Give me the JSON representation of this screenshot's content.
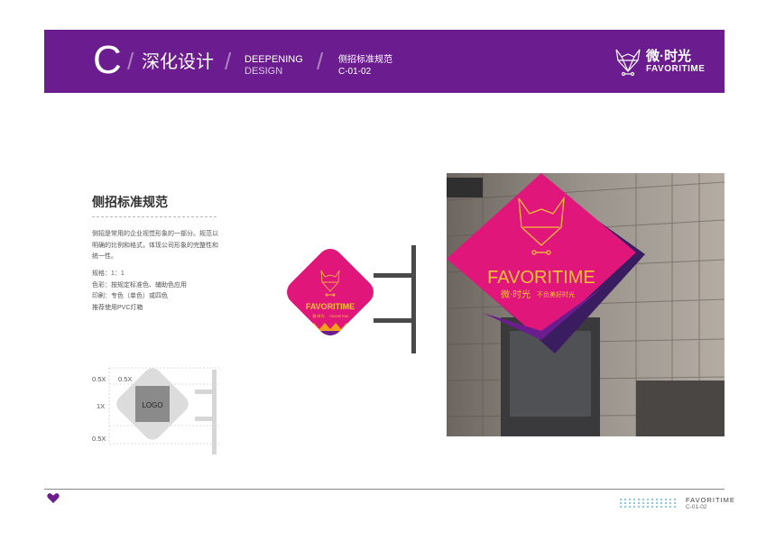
{
  "header": {
    "letter": "C",
    "title_cn": "深化设计",
    "title_en_1": "DEEPENING",
    "title_en_2": "DESIGN",
    "subtitle_cn": "侧招标准规范",
    "code": "C-01-02",
    "brand_cn": "微·时光",
    "brand_en": "FAVORITIME",
    "color": "#6b1d8f"
  },
  "section": {
    "title": "侧招标准规范",
    "description": "侧招是常用的企业视觉形象的一部分。规范以明确的比例和格式，体现公司形象的完整性和统一性。",
    "specs": [
      "规格：1：1",
      "色彩：按规定标准色、辅助色应用",
      "印刷：专色（单色）或四色",
      "推荐使用PVC灯箱"
    ]
  },
  "diagram": {
    "logo_label": "LOGO",
    "dim_left_top": "0.5X",
    "dim_inner_top": "0.5X",
    "dim_middle": "1X",
    "dim_bottom": "0.5X"
  },
  "sign": {
    "brand_en": "FAVORITIME",
    "brand_cn": "微·时光",
    "tagline": "FAVORITIME"
  },
  "photo": {
    "sign_brand_en": "FAVORITIME",
    "sign_brand_cn": "微·时光",
    "sign_tagline": "不负美好时光"
  },
  "footer": {
    "brand": "FAVORITIME",
    "code": "C-01-02"
  },
  "colors": {
    "purple": "#6b1d8f",
    "magenta": "#e0167a",
    "orange": "#f7a11a"
  }
}
